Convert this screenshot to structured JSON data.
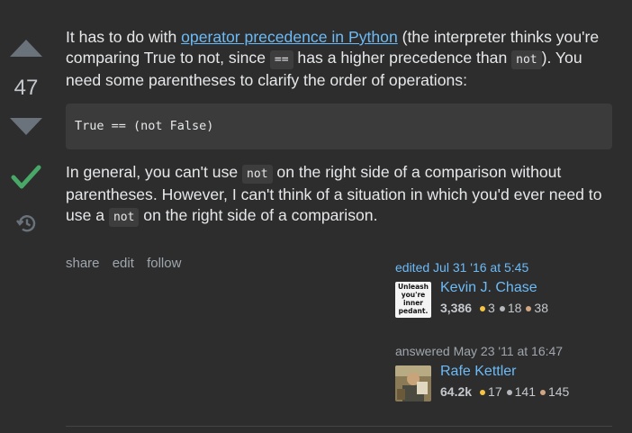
{
  "vote": {
    "score": "47"
  },
  "answer": {
    "para1": {
      "t1": "It has to do with ",
      "link": "operator precedence in Python",
      "t2": " (the interpreter thinks you're comparing True to not, since ",
      "code1": "==",
      "t3": " has a higher precedence than ",
      "code2": "not",
      "t4": "). You need some parentheses to clarify the order of operations:"
    },
    "codeblock": "True == (not False)",
    "para2": {
      "t1": "In general, you can't use ",
      "code1": "not",
      "t2": " on the right side of a comparison without parentheses. However, I can't think of a situation in which you'd ever need to use a ",
      "code2": "not",
      "t3": " on the right side of a comparison."
    }
  },
  "actions": {
    "share": "share",
    "edit": "edit",
    "follow": "follow"
  },
  "editor": {
    "action": "edited Jul 31 '16 at 5:45",
    "avatar_text": "Unleash you're inner pedant.",
    "name": "Kevin J. Chase",
    "reputation": "3,386",
    "gold": "3",
    "silver": "18",
    "bronze": "38"
  },
  "author": {
    "action": "answered May 23 '11 at 16:47",
    "name": "Rafe Kettler",
    "reputation": "64.2k",
    "gold": "17",
    "silver": "141",
    "bronze": "145"
  },
  "colors": {
    "link": "#6cbbf7",
    "accepted": "#48a868",
    "background": "#2d2d2d"
  }
}
